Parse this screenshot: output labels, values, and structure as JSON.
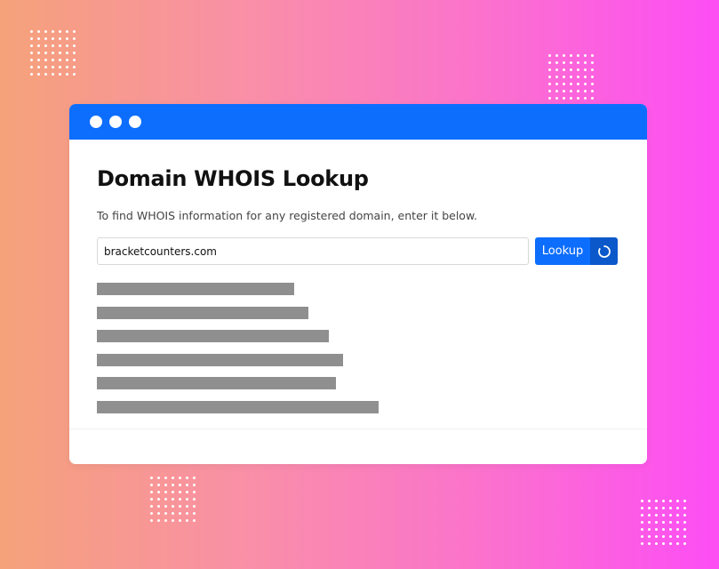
{
  "window": {
    "titlebar_buttons": [
      "dot",
      "dot",
      "dot"
    ]
  },
  "main": {
    "title": "Domain WHOIS Lookup",
    "subtitle": "To find WHOIS information for any registered domain, enter it below.",
    "search": {
      "value": "bracketcounters.com"
    },
    "lookup_label": "Lookup",
    "loading_icon": "spinner-icon",
    "skeleton_rows": 6
  },
  "colors": {
    "accent": "#0d6efd",
    "accent_dark": "#0a58ca",
    "skeleton": "#8f8f8f"
  }
}
